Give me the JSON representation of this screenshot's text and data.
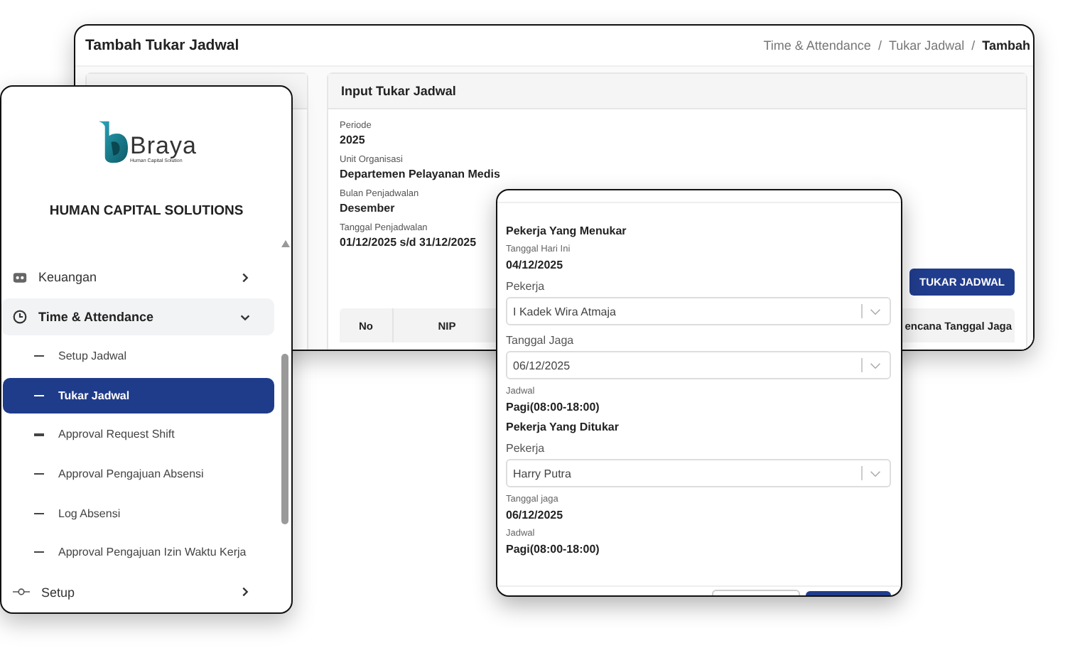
{
  "main_window": {
    "title": "Tambah Tukar Jadwal",
    "breadcrumb_separators": [
      "/",
      "/"
    ],
    "breadcrumb": [
      {
        "label": "Time & Attendance",
        "current": false
      },
      {
        "label": "Tukar Jadwal",
        "current": false
      },
      {
        "label": "Tambah",
        "current": true
      }
    ],
    "input_card": {
      "title": "Input Tukar Jadwal",
      "fields": [
        {
          "label": "Periode",
          "value": "2025"
        },
        {
          "label": "Unit Organisasi",
          "value": "Departemen Pelayanan Medis"
        },
        {
          "label": "Bulan Penjadwalan",
          "value": "Desember"
        },
        {
          "label": "Tanggal Penjadwalan",
          "value": "01/12/2025 s/d 31/12/2025"
        }
      ],
      "button": "TUKAR JADWAL",
      "table": {
        "columns": [
          "No",
          "NIP"
        ],
        "column_last": "encana Tanggal Jaga"
      }
    }
  },
  "sidebar": {
    "logo": {
      "name": "Braya",
      "tagline": "Human Capital Solution"
    },
    "brand": "HUMAN CAPITAL SOLUTIONS",
    "items": [
      {
        "label": "Keuangan",
        "expanded": false
      },
      {
        "label": "Time & Attendance",
        "expanded": true,
        "children": [
          {
            "label": "Setup Jadwal",
            "selected": false
          },
          {
            "label": "Tukar Jadwal",
            "selected": true
          },
          {
            "label": "Approval Request Shift",
            "selected": false
          },
          {
            "label": "Approval Pengajuan Absensi",
            "selected": false
          },
          {
            "label": "Log Absensi",
            "selected": false
          },
          {
            "label": "Approval Pengajuan Izin Waktu Kerja",
            "selected": false
          }
        ]
      },
      {
        "label": "Setup",
        "expanded": false
      }
    ]
  },
  "dialog": {
    "sections": [
      {
        "title": "Pekerja Yang Menukar",
        "rows": [
          {
            "kind": "info",
            "label": "Tanggal Hari Ini",
            "value": "04/12/2025"
          },
          {
            "kind": "select",
            "label": "Pekerja",
            "value": "I Kadek Wira Atmaja"
          },
          {
            "kind": "select",
            "label": "Tanggal Jaga",
            "value": "06/12/2025"
          },
          {
            "kind": "info",
            "label": "Jadwal",
            "value": "Pagi(08:00-18:00)"
          }
        ]
      },
      {
        "title": "Pekerja Yang Ditukar",
        "rows": [
          {
            "kind": "select",
            "label": "Pekerja",
            "value": "Harry Putra"
          },
          {
            "kind": "info",
            "label": "Tanggal jaga",
            "value": "06/12/2025"
          },
          {
            "kind": "info",
            "label": "Jadwal",
            "value": "Pagi(08:00-18:00)"
          }
        ]
      }
    ]
  }
}
